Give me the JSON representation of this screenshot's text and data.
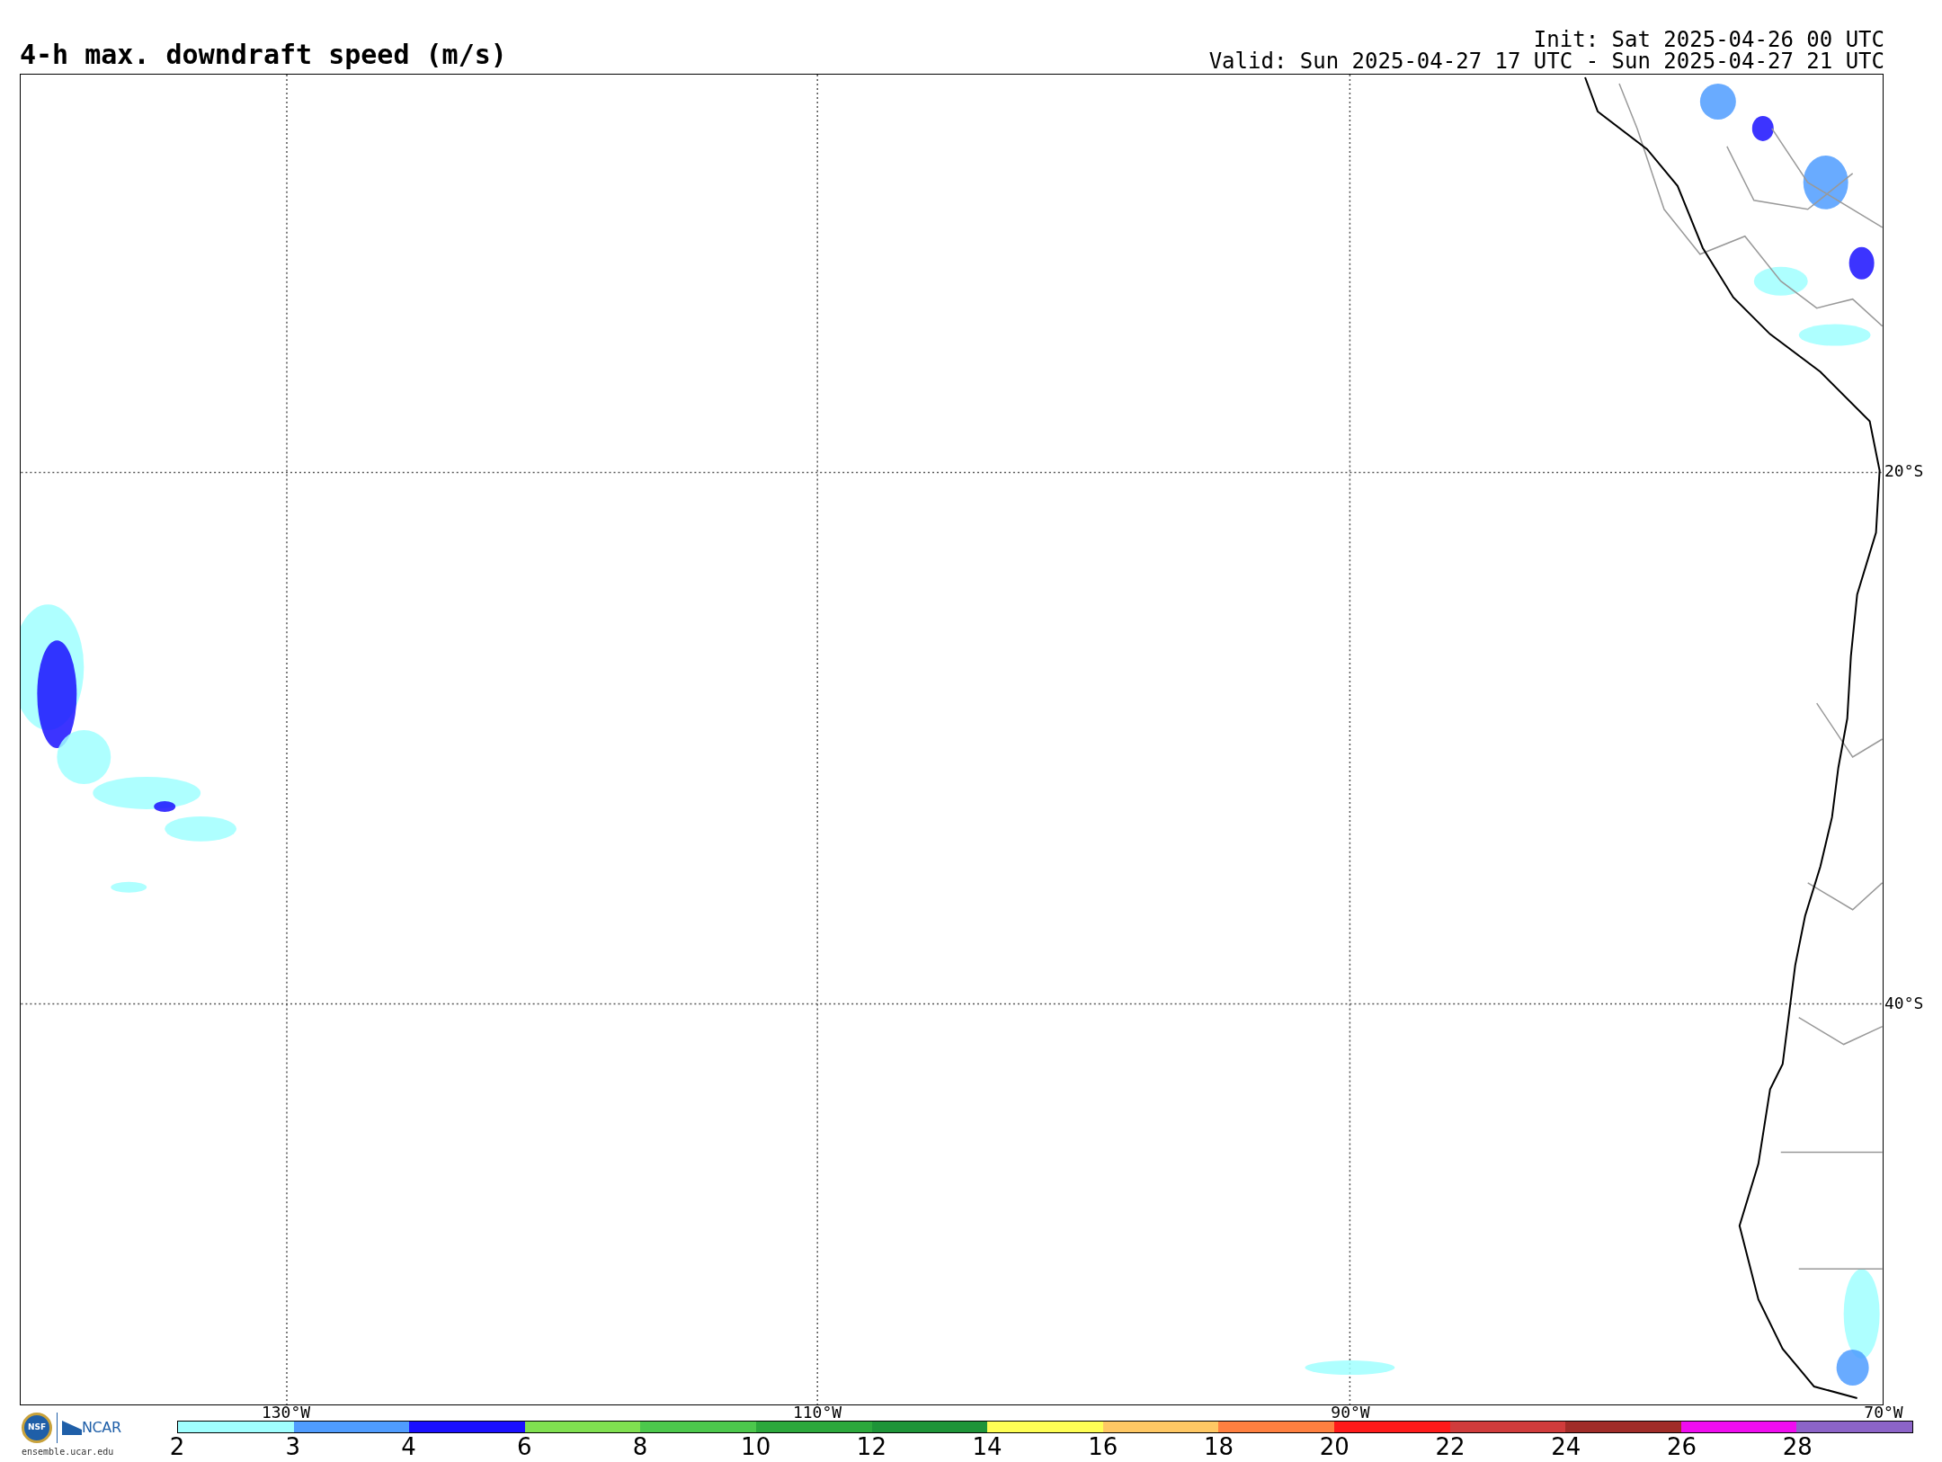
{
  "title": "4-h max. downdraft speed (m/s)",
  "init": "Init: Sat 2025-04-26 00 UTC",
  "valid": "Valid: Sun 2025-04-27 17 UTC - Sun 2025-04-27 21 UTC",
  "map": {
    "lat_labels": [
      "20°S",
      "40°S"
    ],
    "lon_labels": [
      "130°W",
      "110°W",
      "90°W",
      "70°W"
    ]
  },
  "colorbar": {
    "bins": [
      {
        "color": "#a0ffff"
      },
      {
        "color": "#4f9cff"
      },
      {
        "color": "#1a10ff"
      },
      {
        "color": "#80e050"
      },
      {
        "color": "#4cc84c"
      },
      {
        "color": "#2ca83c"
      },
      {
        "color": "#1e9438"
      },
      {
        "color": "#ffff55"
      },
      {
        "color": "#ffc864"
      },
      {
        "color": "#ff8040"
      },
      {
        "color": "#ff1a1a"
      },
      {
        "color": "#d03c3c"
      },
      {
        "color": "#a02c28"
      },
      {
        "color": "#f00cf0"
      },
      {
        "color": "#8c64c8"
      }
    ],
    "tick_labels": [
      "2",
      "3",
      "4",
      "6",
      "8",
      "10",
      "12",
      "14",
      "16",
      "18",
      "20",
      "22",
      "24",
      "26",
      "28"
    ]
  },
  "logo": {
    "seal": "NSF",
    "name": "NCAR",
    "url": "ensemble.ucar.edu"
  }
}
